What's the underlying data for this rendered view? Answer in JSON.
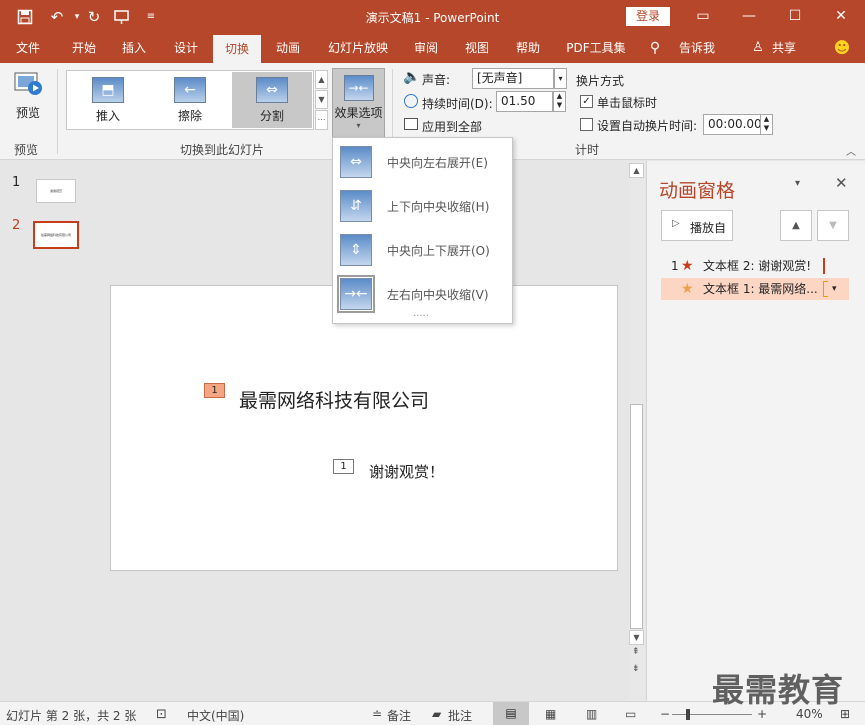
{
  "window": {
    "title": "演示文稿1  -  PowerPoint",
    "login_label": "登录",
    "quick_access": [
      "save-icon",
      "undo-icon",
      "redo-icon",
      "present-icon",
      "customize-icon"
    ],
    "controls": [
      "ribbon-display-icon",
      "minimize-icon",
      "maximize-icon",
      "close-icon"
    ]
  },
  "tabs": [
    "文件",
    "开始",
    "插入",
    "设计",
    "切换",
    "动画",
    "幻灯片放映",
    "审阅",
    "视图",
    "帮助",
    "PDF工具集",
    "告诉我",
    "共享"
  ],
  "active_tab": "切换",
  "ribbon": {
    "preview": {
      "label": "预览",
      "group": "预览"
    },
    "gallery": {
      "group": "切换到此幻灯片",
      "items": [
        {
          "label": "推入",
          "icon": "push-icon"
        },
        {
          "label": "擦除",
          "icon": "wipe-icon"
        },
        {
          "label": "分割",
          "icon": "split-icon"
        }
      ],
      "selected": "分割"
    },
    "effect_options": {
      "label": "效果选项"
    },
    "timing": {
      "group": "计时",
      "sound_label": "声音:",
      "sound_value": "[无声音]",
      "duration_label": "持续时间(D):",
      "duration_value": "01.50",
      "apply_all_label": "应用到全部",
      "advance_title": "换片方式",
      "on_click_label": "单击鼠标时",
      "on_click_checked": true,
      "auto_label": "设置自动换片时间:",
      "auto_checked": false,
      "auto_value": "00:00.00"
    }
  },
  "effect_menu": {
    "items": [
      {
        "label": "中央向左右展开(E)",
        "icon": "horizontal-out-icon"
      },
      {
        "label": "上下向中央收缩(H)",
        "icon": "vertical-in-icon"
      },
      {
        "label": "中央向上下展开(O)",
        "icon": "vertical-out-icon"
      },
      {
        "label": "左右向中央收缩(V)",
        "icon": "horizontal-in-icon"
      }
    ],
    "selected": "左右向中央收缩(V)",
    "more": "....."
  },
  "slides": [
    {
      "number": "1",
      "thumb_text": "谢谢观赏"
    },
    {
      "number": "2",
      "thumb_text": "最需网络科技有限公司"
    }
  ],
  "current_slide": 2,
  "slide_content": {
    "title": "最需网络科技有限公司",
    "title_tag": "1",
    "subtitle": "谢谢观赏！",
    "subtitle_tag": "1"
  },
  "animation_pane": {
    "title": "动画窗格",
    "play_label": "播放自",
    "items": [
      {
        "index": "1",
        "label": "文本框 2: 谢谢观赏!",
        "star_color": "#c43e1c"
      },
      {
        "index": "",
        "label": "文本框 1: 最需网络...",
        "star_color": "#f0a04b",
        "selected": true
      }
    ]
  },
  "status_bar": {
    "slide_info": "幻灯片 第 2 张，共 2 张",
    "language": "中文(中国)",
    "notes_label": "备注",
    "comments_label": "批注",
    "zoom": "40%"
  },
  "watermark": "最需教育",
  "colors": {
    "accent": "#b7472a",
    "ribbon": "#f3f3f3",
    "selected": "#c8c8c8"
  }
}
